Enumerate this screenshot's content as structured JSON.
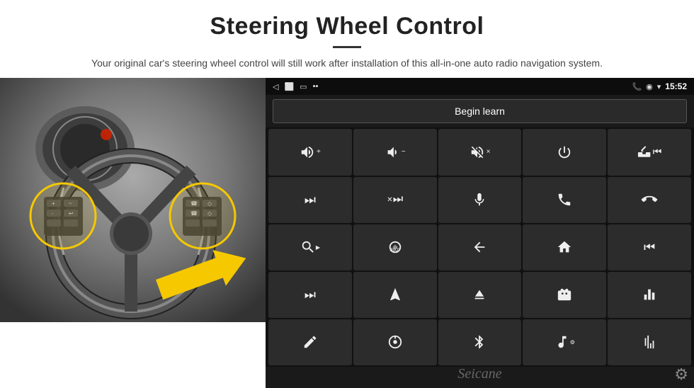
{
  "header": {
    "title": "Steering Wheel Control",
    "subtitle": "Your original car's steering wheel control will still work after installation of this all-in-one auto radio navigation system."
  },
  "status_bar": {
    "time": "15:52",
    "icons": [
      "back",
      "home",
      "square",
      "signal"
    ]
  },
  "begin_learn": {
    "label": "Begin learn"
  },
  "grid_buttons": [
    {
      "id": "vol-up",
      "icon": "vol-up"
    },
    {
      "id": "vol-down",
      "icon": "vol-down"
    },
    {
      "id": "mute",
      "icon": "mute"
    },
    {
      "id": "power",
      "icon": "power"
    },
    {
      "id": "prev-track",
      "icon": "prev-track"
    },
    {
      "id": "skip-fwd",
      "icon": "skip-fwd"
    },
    {
      "id": "shuffle",
      "icon": "shuffle"
    },
    {
      "id": "mic",
      "icon": "mic"
    },
    {
      "id": "phone",
      "icon": "phone"
    },
    {
      "id": "hang-up",
      "icon": "hang-up"
    },
    {
      "id": "horn",
      "icon": "horn"
    },
    {
      "id": "360-cam",
      "icon": "360-cam"
    },
    {
      "id": "back-nav",
      "icon": "back-nav"
    },
    {
      "id": "home-nav",
      "icon": "home-nav"
    },
    {
      "id": "rewind",
      "icon": "rewind"
    },
    {
      "id": "fast-fwd",
      "icon": "fast-fwd"
    },
    {
      "id": "nav",
      "icon": "nav"
    },
    {
      "id": "eject",
      "icon": "eject"
    },
    {
      "id": "radio",
      "icon": "radio"
    },
    {
      "id": "eq",
      "icon": "eq"
    },
    {
      "id": "pen",
      "icon": "pen"
    },
    {
      "id": "settings-knob",
      "icon": "settings-knob"
    },
    {
      "id": "bluetooth",
      "icon": "bluetooth"
    },
    {
      "id": "music",
      "icon": "music"
    },
    {
      "id": "audio-bars",
      "icon": "audio-bars"
    }
  ],
  "watermark": "Seicane",
  "gear_icon": "⚙"
}
